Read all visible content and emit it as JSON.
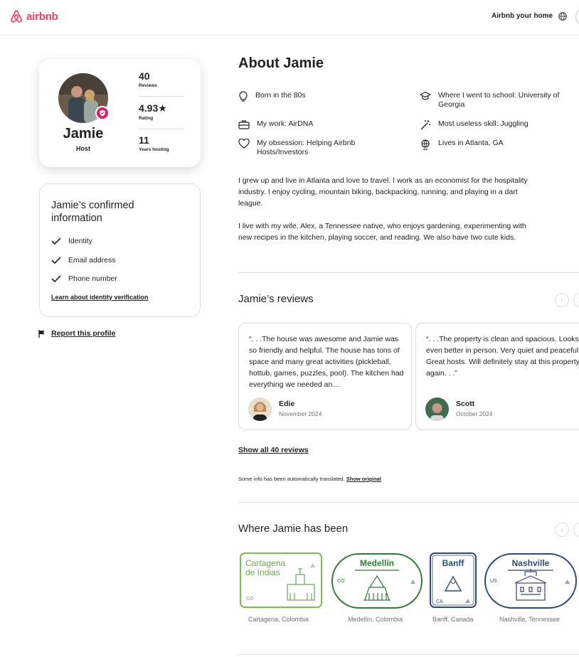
{
  "header": {
    "brand": "airbnb",
    "host_link": "Airbnb your home"
  },
  "colors": {
    "brand": "#ff385c",
    "badge": "#e31c5f",
    "green": "#2f7d32",
    "lime": "#6aa84f",
    "navy": "#2e4a78"
  },
  "profile": {
    "name": "Jamie",
    "role": "Host",
    "stats": [
      {
        "value": "40",
        "label": "Reviews"
      },
      {
        "value": "4.93★",
        "label": "Rating"
      },
      {
        "value": "11",
        "label": "Years hosting"
      }
    ]
  },
  "confirmed": {
    "title": "Jamie’s confirmed information",
    "items": [
      "Identity",
      "Email address",
      "Phone number"
    ],
    "link": "Learn about identity verification"
  },
  "report": "Report this profile",
  "about": {
    "title": "About Jamie",
    "facts": [
      {
        "icon": "bulb-icon",
        "text": "Born in the 80s"
      },
      {
        "icon": "school-icon",
        "text": "Where I went to school: University of Georgia"
      },
      {
        "icon": "briefcase-icon",
        "text": "My work: AirDNA"
      },
      {
        "icon": "magic-wand-icon",
        "text": "Most useless skill: Juggling"
      },
      {
        "icon": "heart-icon",
        "text": "My obsession: Helping Airbnb Hosts/Investors"
      },
      {
        "icon": "globe-pin-icon",
        "text": "Lives in Atlanta, GA"
      }
    ],
    "bio_1": "I grew up and live in Atlanta and love to travel.  I work as an economist for the hospitality industry.  I enjoy cycling, mountain biking, backpacking, running, and playing in a dart league.",
    "bio_2": "I live with my wife, Alex, a Tennessee native, who enjoys gardening, experimenting with new recipes in the kitchen, playing soccer, and reading.  We also have two cute kids."
  },
  "reviews": {
    "title": "Jamie’s reviews",
    "items": [
      {
        "text": "“. . .The house was awesome and Jamie was so friendly and helpful. The house has tons of space and many great activities (pickleball, hottub, games, puzzles, pool). The kitchen had everything we needed an…",
        "name": "Edie",
        "date": "November 2024"
      },
      {
        "text": "“. . .The property is clean and spacious. Looks even better in person. Very quiet and peaceful. Great hosts. Will definitely stay at this property again. . .”",
        "name": "Scott",
        "date": "October 2024"
      }
    ],
    "show_all": "Show all 40 reviews",
    "translated_note": "Some info has been automatically translated.",
    "show_original": "Show original"
  },
  "places": {
    "title": "Where Jamie has been",
    "items": [
      {
        "stamp": "Cartagena de Indias",
        "code": "CO",
        "caption": "Cartagena, Colombia"
      },
      {
        "stamp": "Medellín",
        "code": "CO",
        "caption": "Medellín, Colombia"
      },
      {
        "stamp": "Banff",
        "code": "CA",
        "caption": "Banff, Canada"
      },
      {
        "stamp": "Nashville",
        "code": "US",
        "caption": "Nashville, Tennessee"
      }
    ]
  }
}
